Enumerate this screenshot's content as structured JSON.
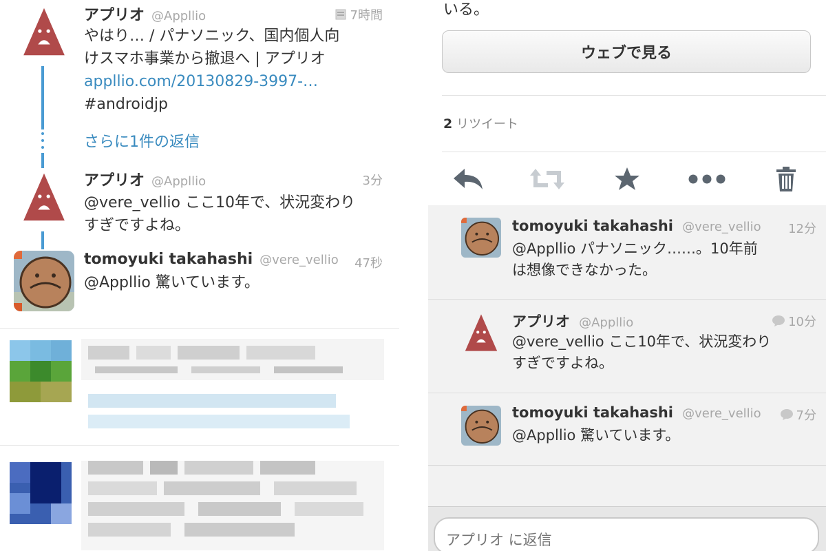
{
  "timeline": {
    "tweet1": {
      "name": "アプリオ",
      "handle": "@Appllio",
      "time": "7時間",
      "text_line1": "やはり… / パナソニック、国内個人向",
      "text_line2": "けスマホ事業から撤退へ | アプリオ",
      "link": "appllio.com/20130829-3997-…",
      "hashtag": "#androidjp"
    },
    "more_replies": "さらに1件の返信",
    "tweet2": {
      "name": "アプリオ",
      "handle": "@Appllio",
      "time": "3分",
      "text_line1": "@vere_vellio ここ10年で、状況変わり",
      "text_line2": "すぎですよね。"
    },
    "tweet3": {
      "name": "tomoyuki takahashi",
      "handle": "@vere_vellio",
      "time": "47秒",
      "text_line1": "@Appllio 驚いています。"
    }
  },
  "detail": {
    "top_text": "いる。",
    "web_button": "ウェブで見る",
    "retweet_count": "2",
    "retweet_label": "リツイート",
    "actions": [
      "reply-icon",
      "retweet-icon",
      "star-icon",
      "more-icon",
      "trash-icon"
    ],
    "replies": [
      {
        "name": "tomoyuki takahashi",
        "handle": "@vere_vellio",
        "time": "12分",
        "text_line1": "@Appllio パナソニック……。10年前",
        "text_line2": "は想像できなかった。"
      },
      {
        "name": "アプリオ",
        "handle": "@Appllio",
        "time": "10分",
        "text_line1": "@vere_vellio ここ10年で、状況変わり",
        "text_line2": "すぎですよね。"
      },
      {
        "name": "tomoyuki takahashi",
        "handle": "@vere_vellio",
        "time": "7分",
        "text_line1": "@Appllio 驚いています。"
      }
    ],
    "reply_placeholder": "アプリオ に返信"
  },
  "colors": {
    "accent_blue": "#3a8bbf",
    "thread_line": "#4a9bd3",
    "avatar_red": "#b04a4a"
  }
}
